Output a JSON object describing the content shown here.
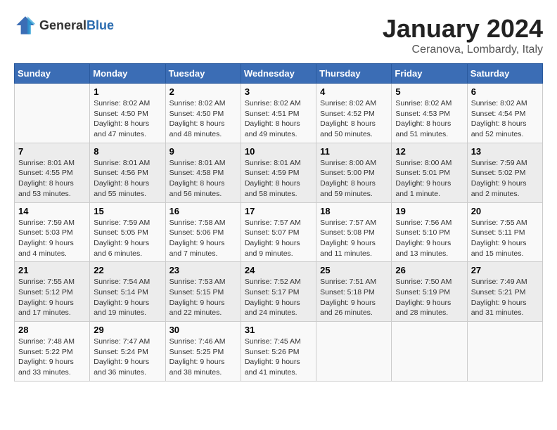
{
  "header": {
    "logo_general": "General",
    "logo_blue": "Blue",
    "month": "January 2024",
    "location": "Ceranova, Lombardy, Italy"
  },
  "weekdays": [
    "Sunday",
    "Monday",
    "Tuesday",
    "Wednesday",
    "Thursday",
    "Friday",
    "Saturday"
  ],
  "weeks": [
    [
      {
        "day": "",
        "sunrise": "",
        "sunset": "",
        "daylight": ""
      },
      {
        "day": "1",
        "sunrise": "Sunrise: 8:02 AM",
        "sunset": "Sunset: 4:50 PM",
        "daylight": "Daylight: 8 hours and 47 minutes."
      },
      {
        "day": "2",
        "sunrise": "Sunrise: 8:02 AM",
        "sunset": "Sunset: 4:50 PM",
        "daylight": "Daylight: 8 hours and 48 minutes."
      },
      {
        "day": "3",
        "sunrise": "Sunrise: 8:02 AM",
        "sunset": "Sunset: 4:51 PM",
        "daylight": "Daylight: 8 hours and 49 minutes."
      },
      {
        "day": "4",
        "sunrise": "Sunrise: 8:02 AM",
        "sunset": "Sunset: 4:52 PM",
        "daylight": "Daylight: 8 hours and 50 minutes."
      },
      {
        "day": "5",
        "sunrise": "Sunrise: 8:02 AM",
        "sunset": "Sunset: 4:53 PM",
        "daylight": "Daylight: 8 hours and 51 minutes."
      },
      {
        "day": "6",
        "sunrise": "Sunrise: 8:02 AM",
        "sunset": "Sunset: 4:54 PM",
        "daylight": "Daylight: 8 hours and 52 minutes."
      }
    ],
    [
      {
        "day": "7",
        "sunrise": "Sunrise: 8:01 AM",
        "sunset": "Sunset: 4:55 PM",
        "daylight": "Daylight: 8 hours and 53 minutes."
      },
      {
        "day": "8",
        "sunrise": "Sunrise: 8:01 AM",
        "sunset": "Sunset: 4:56 PM",
        "daylight": "Daylight: 8 hours and 55 minutes."
      },
      {
        "day": "9",
        "sunrise": "Sunrise: 8:01 AM",
        "sunset": "Sunset: 4:58 PM",
        "daylight": "Daylight: 8 hours and 56 minutes."
      },
      {
        "day": "10",
        "sunrise": "Sunrise: 8:01 AM",
        "sunset": "Sunset: 4:59 PM",
        "daylight": "Daylight: 8 hours and 58 minutes."
      },
      {
        "day": "11",
        "sunrise": "Sunrise: 8:00 AM",
        "sunset": "Sunset: 5:00 PM",
        "daylight": "Daylight: 8 hours and 59 minutes."
      },
      {
        "day": "12",
        "sunrise": "Sunrise: 8:00 AM",
        "sunset": "Sunset: 5:01 PM",
        "daylight": "Daylight: 9 hours and 1 minute."
      },
      {
        "day": "13",
        "sunrise": "Sunrise: 7:59 AM",
        "sunset": "Sunset: 5:02 PM",
        "daylight": "Daylight: 9 hours and 2 minutes."
      }
    ],
    [
      {
        "day": "14",
        "sunrise": "Sunrise: 7:59 AM",
        "sunset": "Sunset: 5:03 PM",
        "daylight": "Daylight: 9 hours and 4 minutes."
      },
      {
        "day": "15",
        "sunrise": "Sunrise: 7:59 AM",
        "sunset": "Sunset: 5:05 PM",
        "daylight": "Daylight: 9 hours and 6 minutes."
      },
      {
        "day": "16",
        "sunrise": "Sunrise: 7:58 AM",
        "sunset": "Sunset: 5:06 PM",
        "daylight": "Daylight: 9 hours and 7 minutes."
      },
      {
        "day": "17",
        "sunrise": "Sunrise: 7:57 AM",
        "sunset": "Sunset: 5:07 PM",
        "daylight": "Daylight: 9 hours and 9 minutes."
      },
      {
        "day": "18",
        "sunrise": "Sunrise: 7:57 AM",
        "sunset": "Sunset: 5:08 PM",
        "daylight": "Daylight: 9 hours and 11 minutes."
      },
      {
        "day": "19",
        "sunrise": "Sunrise: 7:56 AM",
        "sunset": "Sunset: 5:10 PM",
        "daylight": "Daylight: 9 hours and 13 minutes."
      },
      {
        "day": "20",
        "sunrise": "Sunrise: 7:55 AM",
        "sunset": "Sunset: 5:11 PM",
        "daylight": "Daylight: 9 hours and 15 minutes."
      }
    ],
    [
      {
        "day": "21",
        "sunrise": "Sunrise: 7:55 AM",
        "sunset": "Sunset: 5:12 PM",
        "daylight": "Daylight: 9 hours and 17 minutes."
      },
      {
        "day": "22",
        "sunrise": "Sunrise: 7:54 AM",
        "sunset": "Sunset: 5:14 PM",
        "daylight": "Daylight: 9 hours and 19 minutes."
      },
      {
        "day": "23",
        "sunrise": "Sunrise: 7:53 AM",
        "sunset": "Sunset: 5:15 PM",
        "daylight": "Daylight: 9 hours and 22 minutes."
      },
      {
        "day": "24",
        "sunrise": "Sunrise: 7:52 AM",
        "sunset": "Sunset: 5:17 PM",
        "daylight": "Daylight: 9 hours and 24 minutes."
      },
      {
        "day": "25",
        "sunrise": "Sunrise: 7:51 AM",
        "sunset": "Sunset: 5:18 PM",
        "daylight": "Daylight: 9 hours and 26 minutes."
      },
      {
        "day": "26",
        "sunrise": "Sunrise: 7:50 AM",
        "sunset": "Sunset: 5:19 PM",
        "daylight": "Daylight: 9 hours and 28 minutes."
      },
      {
        "day": "27",
        "sunrise": "Sunrise: 7:49 AM",
        "sunset": "Sunset: 5:21 PM",
        "daylight": "Daylight: 9 hours and 31 minutes."
      }
    ],
    [
      {
        "day": "28",
        "sunrise": "Sunrise: 7:48 AM",
        "sunset": "Sunset: 5:22 PM",
        "daylight": "Daylight: 9 hours and 33 minutes."
      },
      {
        "day": "29",
        "sunrise": "Sunrise: 7:47 AM",
        "sunset": "Sunset: 5:24 PM",
        "daylight": "Daylight: 9 hours and 36 minutes."
      },
      {
        "day": "30",
        "sunrise": "Sunrise: 7:46 AM",
        "sunset": "Sunset: 5:25 PM",
        "daylight": "Daylight: 9 hours and 38 minutes."
      },
      {
        "day": "31",
        "sunrise": "Sunrise: 7:45 AM",
        "sunset": "Sunset: 5:26 PM",
        "daylight": "Daylight: 9 hours and 41 minutes."
      },
      {
        "day": "",
        "sunrise": "",
        "sunset": "",
        "daylight": ""
      },
      {
        "day": "",
        "sunrise": "",
        "sunset": "",
        "daylight": ""
      },
      {
        "day": "",
        "sunrise": "",
        "sunset": "",
        "daylight": ""
      }
    ]
  ]
}
